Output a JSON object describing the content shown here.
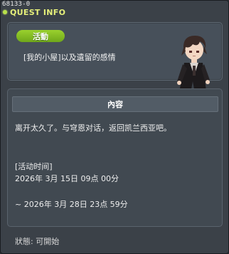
{
  "window": {
    "id_tag": "68133-0",
    "title": "QUEST INFO"
  },
  "quest": {
    "badge": "活動",
    "name": "[我的小屋]以及遺留的感情"
  },
  "content": {
    "header": "內容",
    "description": "离开太久了。与穹恩对话，返回凯兰西亚吧。",
    "period_label": "[活动时间]",
    "start": "2026年 3月 15日 09点 00分",
    "end": "~ 2026年 3月 28日 23点 59分"
  },
  "status": "狀態: 可開始",
  "colors": {
    "title": "#e6f07a",
    "badge": "#8cc427",
    "panel": "#47505a"
  }
}
